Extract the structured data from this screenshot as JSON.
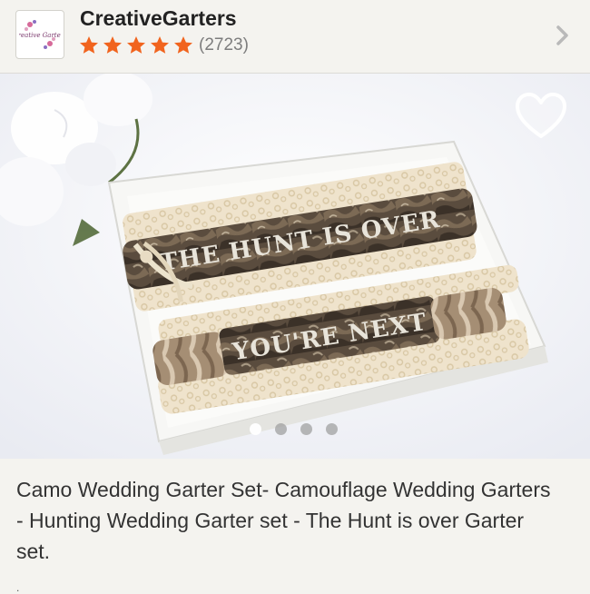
{
  "shop": {
    "name": "CreativeGarters",
    "logo_text": "Creative Garters",
    "rating_stars": 5,
    "review_count": "(2723)"
  },
  "listing": {
    "garter_text_top": "THE HUNT IS OVER",
    "garter_text_bottom": "YOU'RE NEXT",
    "image_count": 4,
    "active_image_index": 0,
    "title": "Camo Wedding Garter Set- Camouflage Wedding Garters - Hunting Wedding Garter set - The Hunt is over Garter set."
  },
  "colors": {
    "star": "#f1641e",
    "background": "#f4f3ef",
    "text": "#333333"
  },
  "icons": {
    "favorite": "heart-outline-icon",
    "navigate": "chevron-right-icon",
    "rating": "star-icon"
  }
}
